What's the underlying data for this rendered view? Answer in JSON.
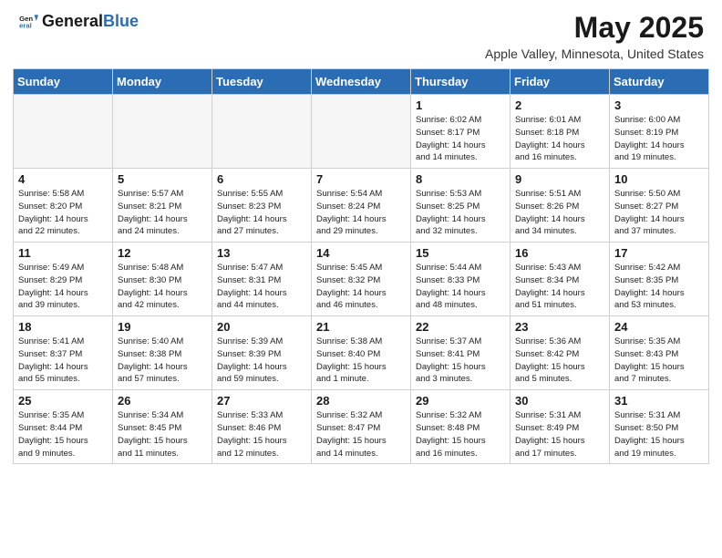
{
  "header": {
    "logo_general": "General",
    "logo_blue": "Blue",
    "month_year": "May 2025",
    "location": "Apple Valley, Minnesota, United States"
  },
  "weekdays": [
    "Sunday",
    "Monday",
    "Tuesday",
    "Wednesday",
    "Thursday",
    "Friday",
    "Saturday"
  ],
  "weeks": [
    [
      {
        "day": "",
        "info": "",
        "empty": true
      },
      {
        "day": "",
        "info": "",
        "empty": true
      },
      {
        "day": "",
        "info": "",
        "empty": true
      },
      {
        "day": "",
        "info": "",
        "empty": true
      },
      {
        "day": "1",
        "info": "Sunrise: 6:02 AM\nSunset: 8:17 PM\nDaylight: 14 hours\nand 14 minutes."
      },
      {
        "day": "2",
        "info": "Sunrise: 6:01 AM\nSunset: 8:18 PM\nDaylight: 14 hours\nand 16 minutes."
      },
      {
        "day": "3",
        "info": "Sunrise: 6:00 AM\nSunset: 8:19 PM\nDaylight: 14 hours\nand 19 minutes."
      }
    ],
    [
      {
        "day": "4",
        "info": "Sunrise: 5:58 AM\nSunset: 8:20 PM\nDaylight: 14 hours\nand 22 minutes."
      },
      {
        "day": "5",
        "info": "Sunrise: 5:57 AM\nSunset: 8:21 PM\nDaylight: 14 hours\nand 24 minutes."
      },
      {
        "day": "6",
        "info": "Sunrise: 5:55 AM\nSunset: 8:23 PM\nDaylight: 14 hours\nand 27 minutes."
      },
      {
        "day": "7",
        "info": "Sunrise: 5:54 AM\nSunset: 8:24 PM\nDaylight: 14 hours\nand 29 minutes."
      },
      {
        "day": "8",
        "info": "Sunrise: 5:53 AM\nSunset: 8:25 PM\nDaylight: 14 hours\nand 32 minutes."
      },
      {
        "day": "9",
        "info": "Sunrise: 5:51 AM\nSunset: 8:26 PM\nDaylight: 14 hours\nand 34 minutes."
      },
      {
        "day": "10",
        "info": "Sunrise: 5:50 AM\nSunset: 8:27 PM\nDaylight: 14 hours\nand 37 minutes."
      }
    ],
    [
      {
        "day": "11",
        "info": "Sunrise: 5:49 AM\nSunset: 8:29 PM\nDaylight: 14 hours\nand 39 minutes."
      },
      {
        "day": "12",
        "info": "Sunrise: 5:48 AM\nSunset: 8:30 PM\nDaylight: 14 hours\nand 42 minutes."
      },
      {
        "day": "13",
        "info": "Sunrise: 5:47 AM\nSunset: 8:31 PM\nDaylight: 14 hours\nand 44 minutes."
      },
      {
        "day": "14",
        "info": "Sunrise: 5:45 AM\nSunset: 8:32 PM\nDaylight: 14 hours\nand 46 minutes."
      },
      {
        "day": "15",
        "info": "Sunrise: 5:44 AM\nSunset: 8:33 PM\nDaylight: 14 hours\nand 48 minutes."
      },
      {
        "day": "16",
        "info": "Sunrise: 5:43 AM\nSunset: 8:34 PM\nDaylight: 14 hours\nand 51 minutes."
      },
      {
        "day": "17",
        "info": "Sunrise: 5:42 AM\nSunset: 8:35 PM\nDaylight: 14 hours\nand 53 minutes."
      }
    ],
    [
      {
        "day": "18",
        "info": "Sunrise: 5:41 AM\nSunset: 8:37 PM\nDaylight: 14 hours\nand 55 minutes."
      },
      {
        "day": "19",
        "info": "Sunrise: 5:40 AM\nSunset: 8:38 PM\nDaylight: 14 hours\nand 57 minutes."
      },
      {
        "day": "20",
        "info": "Sunrise: 5:39 AM\nSunset: 8:39 PM\nDaylight: 14 hours\nand 59 minutes."
      },
      {
        "day": "21",
        "info": "Sunrise: 5:38 AM\nSunset: 8:40 PM\nDaylight: 15 hours\nand 1 minute."
      },
      {
        "day": "22",
        "info": "Sunrise: 5:37 AM\nSunset: 8:41 PM\nDaylight: 15 hours\nand 3 minutes."
      },
      {
        "day": "23",
        "info": "Sunrise: 5:36 AM\nSunset: 8:42 PM\nDaylight: 15 hours\nand 5 minutes."
      },
      {
        "day": "24",
        "info": "Sunrise: 5:35 AM\nSunset: 8:43 PM\nDaylight: 15 hours\nand 7 minutes."
      }
    ],
    [
      {
        "day": "25",
        "info": "Sunrise: 5:35 AM\nSunset: 8:44 PM\nDaylight: 15 hours\nand 9 minutes."
      },
      {
        "day": "26",
        "info": "Sunrise: 5:34 AM\nSunset: 8:45 PM\nDaylight: 15 hours\nand 11 minutes."
      },
      {
        "day": "27",
        "info": "Sunrise: 5:33 AM\nSunset: 8:46 PM\nDaylight: 15 hours\nand 12 minutes."
      },
      {
        "day": "28",
        "info": "Sunrise: 5:32 AM\nSunset: 8:47 PM\nDaylight: 15 hours\nand 14 minutes."
      },
      {
        "day": "29",
        "info": "Sunrise: 5:32 AM\nSunset: 8:48 PM\nDaylight: 15 hours\nand 16 minutes."
      },
      {
        "day": "30",
        "info": "Sunrise: 5:31 AM\nSunset: 8:49 PM\nDaylight: 15 hours\nand 17 minutes."
      },
      {
        "day": "31",
        "info": "Sunrise: 5:31 AM\nSunset: 8:50 PM\nDaylight: 15 hours\nand 19 minutes."
      }
    ]
  ]
}
